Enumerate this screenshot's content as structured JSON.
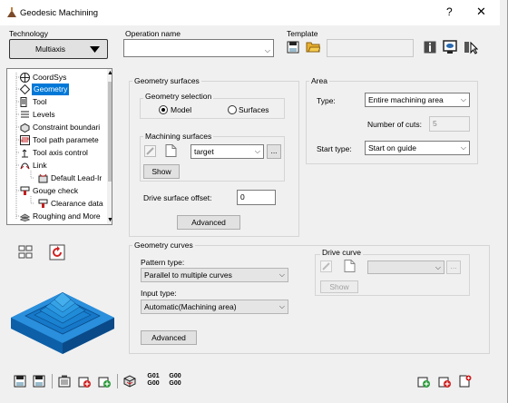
{
  "window": {
    "title": "Geodesic Machining",
    "help_label": "?",
    "close_label": "✕"
  },
  "technology": {
    "label": "Technology",
    "value": "Multiaxis"
  },
  "operation": {
    "label": "Operation name",
    "value": ""
  },
  "template": {
    "label": "Template"
  },
  "tree": {
    "items": [
      {
        "label": "CoordSys"
      },
      {
        "label": "Geometry"
      },
      {
        "label": "Tool"
      },
      {
        "label": "Levels"
      },
      {
        "label": "Constraint boundari"
      },
      {
        "label": "Tool path paramete"
      },
      {
        "label": "Tool axis control"
      },
      {
        "label": "Link"
      },
      {
        "label": "Default Lead-Ir"
      },
      {
        "label": "Gouge check"
      },
      {
        "label": "Clearance data"
      },
      {
        "label": "Roughing and More"
      }
    ]
  },
  "geometry_surfaces": {
    "title": "Geometry surfaces",
    "selection": {
      "title": "Geometry selection",
      "model_label": "Model",
      "surfaces_label": "Surfaces",
      "selected": "Model"
    },
    "machining": {
      "title": "Machining surfaces",
      "value": "target",
      "ellipsis": "...",
      "show_label": "Show"
    },
    "drive_offset": {
      "label": "Drive surface offset:",
      "value": "0"
    },
    "advanced_label": "Advanced"
  },
  "area": {
    "title": "Area",
    "type_label": "Type:",
    "type_value": "Entire machining area",
    "cuts_label": "Number of cuts:",
    "cuts_value": "5",
    "start_label": "Start type:",
    "start_value": "Start on guide"
  },
  "geometry_curves": {
    "title": "Geometry curves",
    "pattern_label": "Pattern type:",
    "pattern_value": "Parallel to multiple curves",
    "input_label": "Input type:",
    "input_value": "Automatic(Machining area)",
    "advanced_label": "Advanced",
    "drive_curve": {
      "title": "Drive curve",
      "ellipsis": "...",
      "show_label": "Show"
    }
  },
  "footer": {
    "label_g01": "G01",
    "label_g00": "G00"
  },
  "colors": {
    "selection": "#0078d7",
    "preview_blue": "#1a8ad6",
    "icon_red": "#d02020",
    "icon_green": "#2a9a3a"
  }
}
